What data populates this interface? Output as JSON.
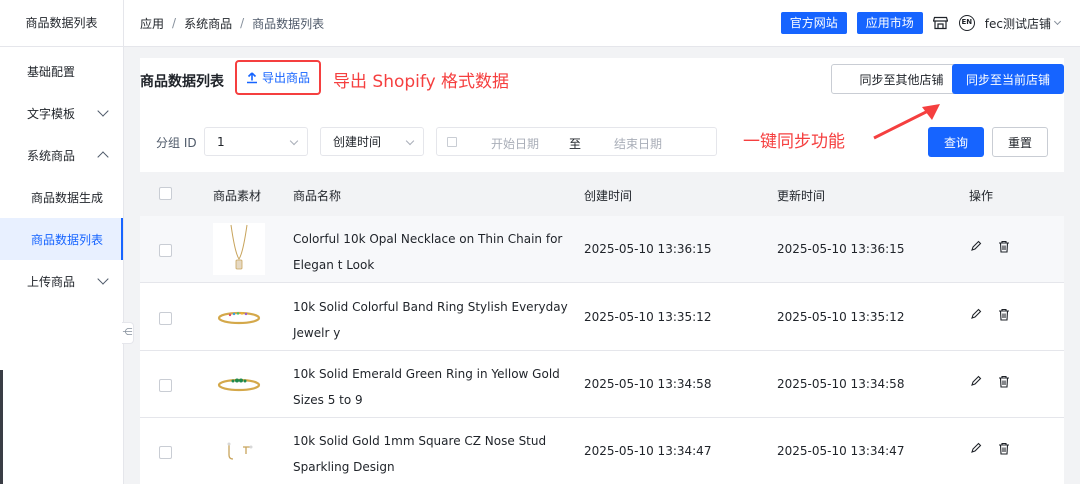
{
  "sidebar": {
    "title": "商品数据列表",
    "items": [
      {
        "label": "基础配置"
      },
      {
        "label": "文字模板"
      },
      {
        "label": "系统商品"
      },
      {
        "label": "商品数据生成"
      },
      {
        "label": "商品数据列表"
      },
      {
        "label": "上传商品"
      }
    ],
    "collapse_glyph": "⋲"
  },
  "header": {
    "breadcrumb": [
      "应用",
      "系统商品",
      "商品数据列表"
    ],
    "separator": "/",
    "official_site": "官方网站",
    "app_market": "应用市场",
    "lang": "EN",
    "user": "fec测试店铺"
  },
  "toolbar": {
    "page_title": "商品数据列表",
    "export_label": "导出商品",
    "export_annotation": "导出 Shopify 格式数据",
    "sync_other": "同步至其他店铺",
    "sync_current": "同步至当前店铺",
    "sync_annotation": "一键同步功能"
  },
  "filters": {
    "group_label": "分组 ID",
    "group_value": "1",
    "sort_value": "创建时间",
    "start_placeholder": "开始日期",
    "to": "至",
    "end_placeholder": "结束日期",
    "query": "查询",
    "reset": "重置"
  },
  "table": {
    "columns": [
      "商品素材",
      "商品名称",
      "创建时间",
      "更新时间",
      "操作"
    ],
    "rows": [
      {
        "name": "Colorful 10k Opal Necklace on Thin Chain for Elegan t Look",
        "created": "2025-05-10 13:36:15",
        "updated": "2025-05-10 13:36:15"
      },
      {
        "name": "10k Solid Colorful Band Ring Stylish Everyday Jewelr y",
        "created": "2025-05-10 13:35:12",
        "updated": "2025-05-10 13:35:12"
      },
      {
        "name": "10k Solid Emerald Green Ring in Yellow Gold Sizes 5 to 9",
        "created": "2025-05-10 13:34:58",
        "updated": "2025-05-10 13:34:58"
      },
      {
        "name": "10k Solid Gold 1mm Square CZ Nose Stud Sparkling Design",
        "created": "2025-05-10 13:34:47",
        "updated": "2025-05-10 13:34:47"
      }
    ]
  },
  "colors": {
    "accent": "#1664ff",
    "annotation": "#f53f3f"
  },
  "icons": [
    "upload-icon",
    "edit-icon",
    "delete-icon",
    "store-icon",
    "language-icon",
    "calendar-icon"
  ]
}
